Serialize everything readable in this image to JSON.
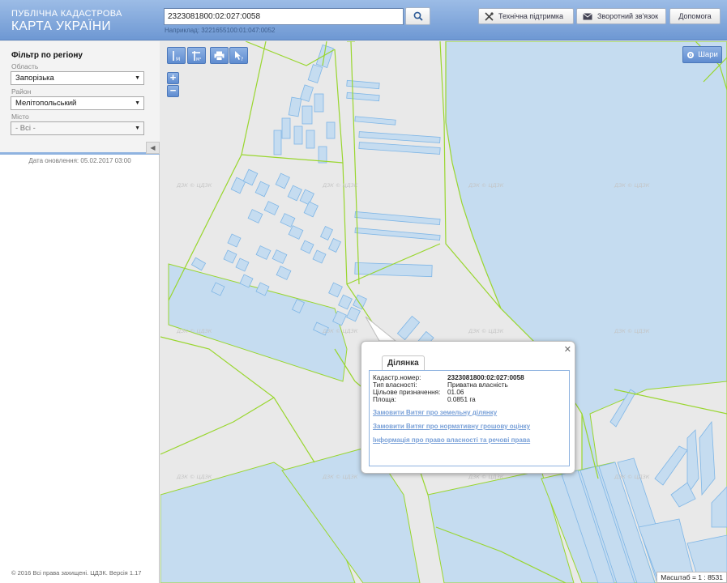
{
  "header": {
    "brand_line1": "ПУБЛІЧНА КАДАСТРОВА",
    "brand_line2": "КАРТА УКРАЇНИ",
    "search_value": "2323081800:02:027:0058",
    "search_hint": "Наприклад: 3221655100:01:047:0052",
    "buttons": {
      "support": "Технічна підтримка",
      "feedback": "Зворотний зв'язок",
      "help": "Допомога"
    }
  },
  "sidebar": {
    "filter_title": "Фільтр по регіону",
    "region_label": "Область",
    "region_value": "Запорізька",
    "district_label": "Район",
    "district_value": "Мелітопольський",
    "city_label": "Місто",
    "city_value": "- Всі -",
    "update_date": "Дата оновлення: 05.02.2017 03:00",
    "footer": "© 2016 Всі права захищені. ЦДЗК. Версія 1.17"
  },
  "map": {
    "layers_label": "Шари",
    "scale_text": "Масштаб = 1 : 8531",
    "watermark": "ДЗК © ЦДЗК",
    "water_color": "#c5dcf0",
    "boundary_color": "#99d62e",
    "land_color": "#e9e9e9"
  },
  "popup": {
    "tab_label": "Ділянка",
    "rows": [
      {
        "key": "Кадастр.номер:",
        "value": "2323081800:02:027:0058"
      },
      {
        "key": "Тип власності:",
        "value": "Приватна власність"
      },
      {
        "key": "Цільове призначення:",
        "value": "01.06"
      },
      {
        "key": "Площа:",
        "value": "0.0851 га"
      }
    ],
    "links": [
      "Замовити Витяг про земельну ділянку",
      "Замовити Витяг про нормативну грошову оцінку",
      "Інформація про право власності та речові права"
    ]
  }
}
